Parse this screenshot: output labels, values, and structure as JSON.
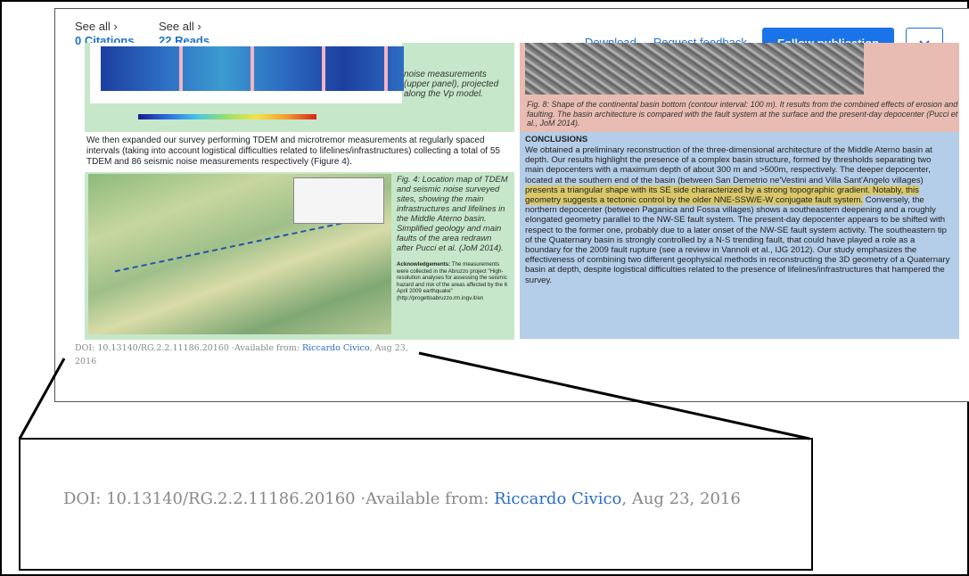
{
  "header": {
    "citations_see_all": "See all ›",
    "citations_value": "0 Citations",
    "reads_see_all": "See all ›",
    "reads_value": "22 Reads",
    "download_label": "Download",
    "request_feedback_label": "Request feedback",
    "follow_label": "Follow publication",
    "dropdown_icon": "chevron-down-icon",
    "accent_color": "#1a73e8"
  },
  "poster": {
    "vp_caption": "noise measurements (upper panel), projected along the Vp model.",
    "fig8_caption": "Fig. 8: Shape of the continental basin bottom (contour interval: 100 m). It results from the combined effects of erosion and faulting. The basin architecture is compared with the fault system at the surface and the present-day depocenter (Pucci et al., JoM 2014).",
    "survey_text": "We then expanded our survey performing TDEM and microtremor measurements at regularly spaced intervals (taking into account logistical difficulties related to lifelines/infrastructures) collecting a total of 55 TDEM and 86 seismic noise measurements respectively (Figure 4).",
    "fig4_caption": "Fig. 4: Location map of TDEM and seismic noise surveyed sites, showing the main infrastructures and lifelines in the Middle Aterno basin. Simplified geology and main faults of the area redrawn after Pucci et al. (JoM 2014).",
    "ack_label": "Acknowledgements:",
    "ack_text": "The measurements were collected in the Abruzzo project \"High-resolution analyses for assessing the seismic hazard and risk of the areas affected by the 6 April 2009 earthquake\" (http://progettoabruzzo.rm.ingv.it/en",
    "conclusions_title": "CONCLUSIONS",
    "conclusions_part1": "We obtained a preliminary reconstruction of the three-dimensional architecture of the Middle Aterno basin at depth. Our results highlight the presence of a complex basin structure, formed by thresholds separating two main depocenters with a maximum depth of about 300 m and >500m, respectively. The deeper depocenter, located at the southern end of the basin (between San Demetrio ne'Vestini and Villa Sant'Angelo villages)",
    "conclusions_highlight": "presents a triangular shape with its SE side characterized by a strong topographic gradient. Notably, this geometry suggests a tectonic control by the older NNE-SSW/E-W conjugate fault system.",
    "conclusions_part2": "Conversely, the northern depocenter (between Paganica and Fossa villages) shows a southeastern deepening and a roughly elongated geometry parallel to the NW-SE fault system. The present-day depocenter appears to be shifted with respect to the former one, probably due to a later onset of the NW-SE fault system activity. The southeastern tip of the Quaternary basin is strongly controlled by a N-S trending fault, that could have played a role as a boundary for the 2009 fault rupture (see a review in Vannoli et al., IJG 2012). Our study emphasizes the effectiveness of combining two different geophysical methods in reconstructing the 3D geometry of a Quaternary basin at depth, despite logistical difficulties related to the presence of lifelines/infrastructures that hampered the survey.",
    "highlight_color": "#d8c86a"
  },
  "doi": {
    "prefix": "DOI: 10.13140/RG.2.2.11186.20160 ·Available from: ",
    "author": "Riccardo Civico",
    "suffix": ", Aug 23, 2016"
  }
}
